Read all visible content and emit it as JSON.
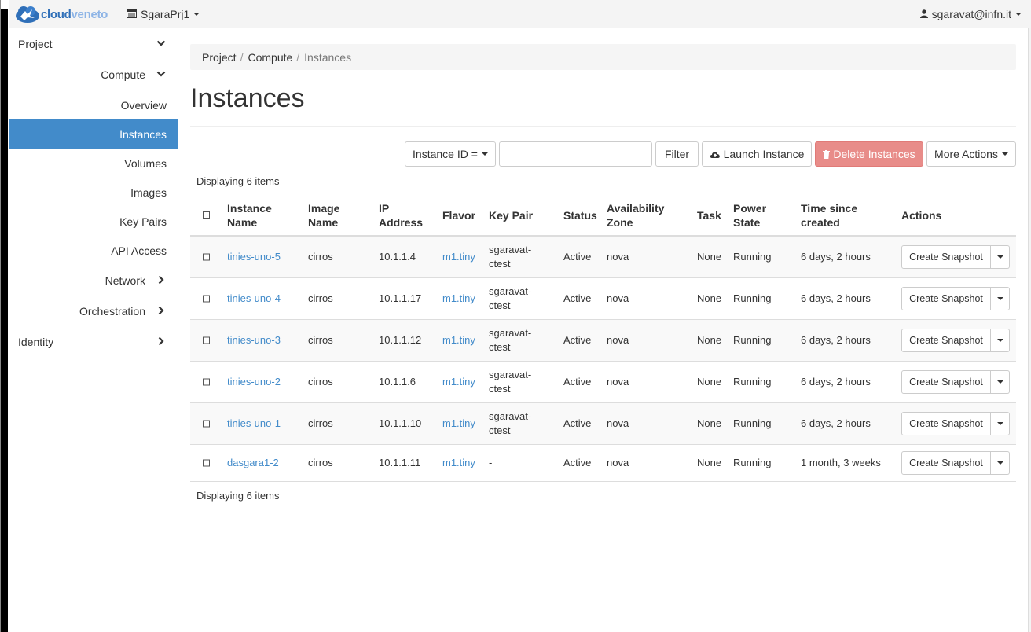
{
  "brand": {
    "name_strong": "cloud",
    "name_light": "veneto"
  },
  "header": {
    "project": "SgaraPrj1",
    "user": "sgaravat@infn.it"
  },
  "sidebar": {
    "project": "Project",
    "compute": "Compute",
    "items": [
      "Overview",
      "Instances",
      "Volumes",
      "Images",
      "Key Pairs",
      "API Access"
    ],
    "network": "Network",
    "orchestration": "Orchestration",
    "identity": "Identity"
  },
  "breadcrumb": [
    "Project",
    "Compute",
    "Instances"
  ],
  "page": {
    "title": "Instances"
  },
  "toolbar": {
    "filter_field": "Instance ID =",
    "filter_button": "Filter",
    "launch": "Launch Instance",
    "delete": "Delete Instances",
    "more": "More Actions"
  },
  "display_count": "Displaying 6 items",
  "table": {
    "headers": {
      "name": [
        "Instance",
        "Name"
      ],
      "image": [
        "Image",
        "Name"
      ],
      "ip": [
        "IP",
        "Address"
      ],
      "flavor": "Flavor",
      "keypair": "Key Pair",
      "status": "Status",
      "zone": [
        "Availability",
        "Zone"
      ],
      "task": "Task",
      "power": [
        "Power",
        "State"
      ],
      "time": [
        "Time since",
        "created"
      ],
      "actions": "Actions"
    },
    "rows": [
      {
        "name": "tinies-uno-5",
        "image": "cirros",
        "ip": "10.1.1.4",
        "flavor": "m1.tiny",
        "keypair": [
          "sgaravat-",
          "ctest"
        ],
        "status": "Active",
        "zone": "nova",
        "task": "None",
        "power": "Running",
        "time": "6 days, 2 hours",
        "action": "Create Snapshot"
      },
      {
        "name": "tinies-uno-4",
        "image": "cirros",
        "ip": "10.1.1.17",
        "flavor": "m1.tiny",
        "keypair": [
          "sgaravat-",
          "ctest"
        ],
        "status": "Active",
        "zone": "nova",
        "task": "None",
        "power": "Running",
        "time": "6 days, 2 hours",
        "action": "Create Snapshot"
      },
      {
        "name": "tinies-uno-3",
        "image": "cirros",
        "ip": "10.1.1.12",
        "flavor": "m1.tiny",
        "keypair": [
          "sgaravat-",
          "ctest"
        ],
        "status": "Active",
        "zone": "nova",
        "task": "None",
        "power": "Running",
        "time": "6 days, 2 hours",
        "action": "Create Snapshot"
      },
      {
        "name": "tinies-uno-2",
        "image": "cirros",
        "ip": "10.1.1.6",
        "flavor": "m1.tiny",
        "keypair": [
          "sgaravat-",
          "ctest"
        ],
        "status": "Active",
        "zone": "nova",
        "task": "None",
        "power": "Running",
        "time": "6 days, 2 hours",
        "action": "Create Snapshot"
      },
      {
        "name": "tinies-uno-1",
        "image": "cirros",
        "ip": "10.1.1.10",
        "flavor": "m1.tiny",
        "keypair": [
          "sgaravat-",
          "ctest"
        ],
        "status": "Active",
        "zone": "nova",
        "task": "None",
        "power": "Running",
        "time": "6 days, 2 hours",
        "action": "Create Snapshot"
      },
      {
        "name": "dasgara1-2",
        "image": "cirros",
        "ip": "10.1.1.11",
        "flavor": "m1.tiny",
        "keypair": [
          "-"
        ],
        "status": "Active",
        "zone": "nova",
        "task": "None",
        "power": "Running",
        "time": "1 month, 3 weeks",
        "action": "Create Snapshot"
      }
    ]
  },
  "colors": {
    "accent": "#428bca",
    "danger": "#e88c89",
    "brand": "#2f6fb8"
  }
}
